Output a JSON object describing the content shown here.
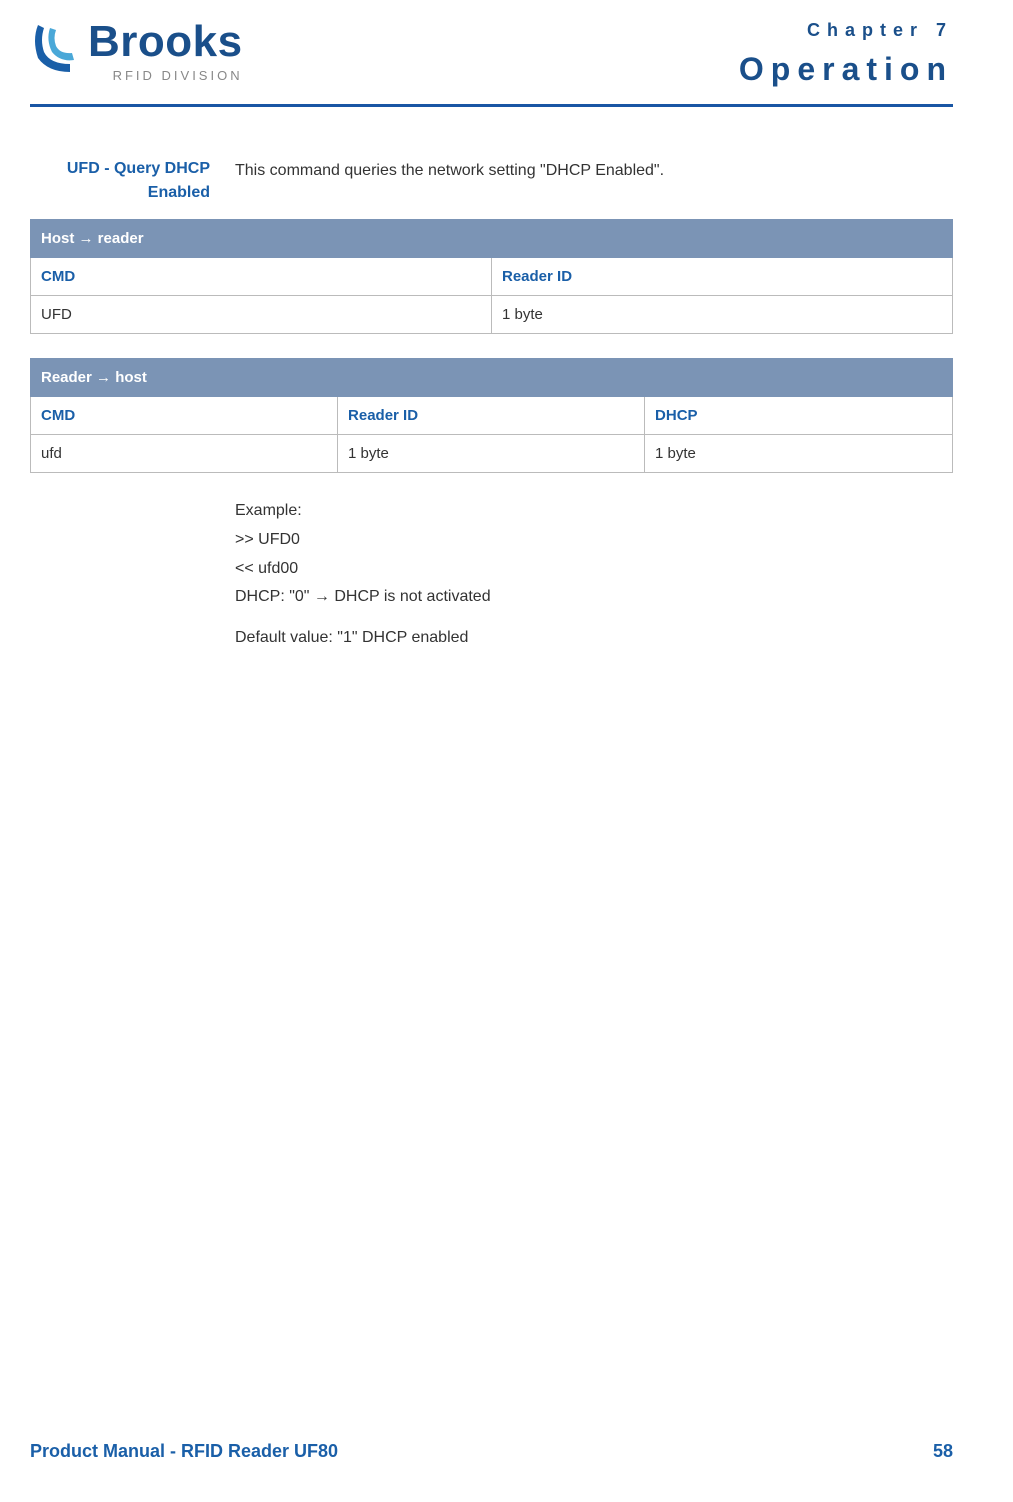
{
  "header": {
    "logo_brand": "Brooks",
    "logo_sub": "RFID DIVISION",
    "chapter_label": "Chapter 7",
    "chapter_title": "Operation"
  },
  "section": {
    "side_label": "UFD - Query DHCP Enabled",
    "intro": "This command queries the network setting \"DHCP Enabled\"."
  },
  "table1": {
    "title": "Host → reader",
    "head": [
      "CMD",
      "Reader ID"
    ],
    "row": [
      "UFD",
      "1 byte"
    ]
  },
  "table2": {
    "title": "Reader → host",
    "head": [
      "CMD",
      "Reader ID",
      "DHCP"
    ],
    "row": [
      "ufd",
      "1 byte",
      "1 byte"
    ]
  },
  "example": {
    "l1": "Example:",
    "l2": ">> UFD0",
    "l3": "<< ufd00",
    "l4": "DHCP: \"0\" → DHCP is not activated",
    "default": "Default value: \"1\" DHCP enabled"
  },
  "footer": {
    "title": "Product Manual - RFID Reader UF80",
    "page": "58"
  }
}
